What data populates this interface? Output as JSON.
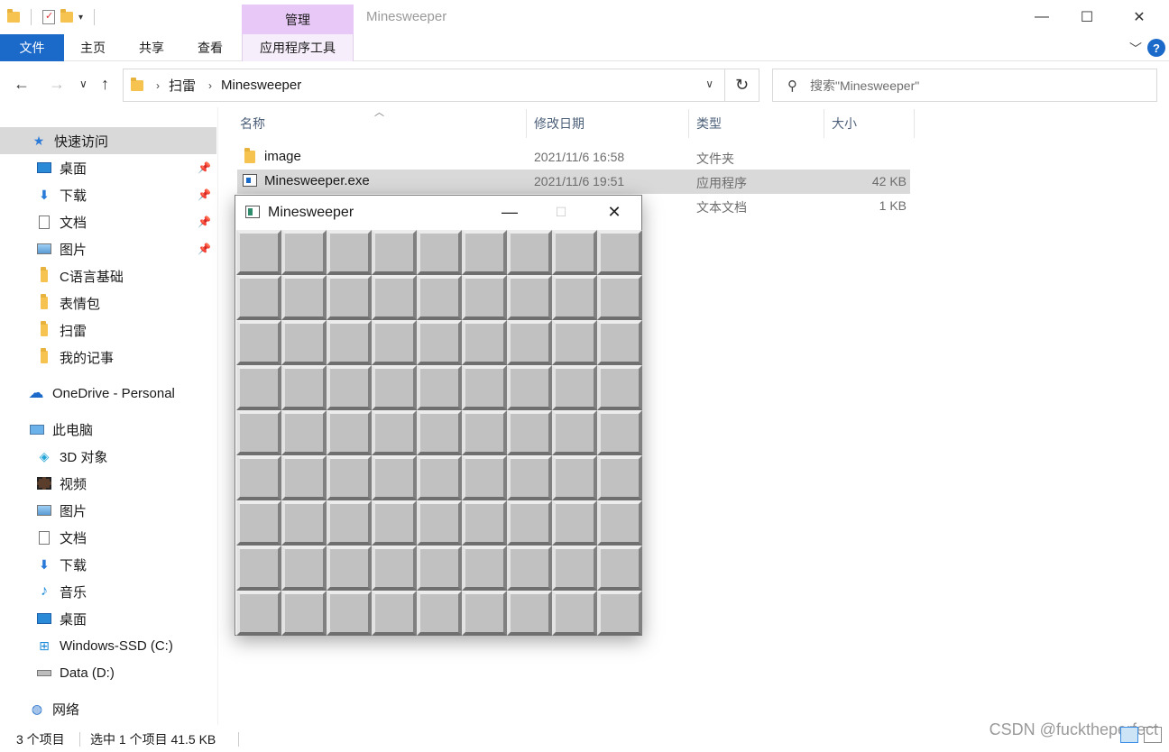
{
  "window": {
    "title": "Minesweeper",
    "context_tab_group": "管理"
  },
  "ribbon": {
    "tabs": [
      "文件",
      "主页",
      "共享",
      "查看",
      "应用程序工具"
    ],
    "help_label": "?"
  },
  "address": {
    "crumbs": [
      "扫雷",
      "Minesweeper"
    ],
    "search_placeholder": "搜索\"Minesweeper\""
  },
  "sidebar": {
    "quick_access": "快速访问",
    "items": [
      {
        "label": "快速访问",
        "icon": "star-icon"
      },
      {
        "label": "桌面",
        "icon": "desktop-icon",
        "pinned": true
      },
      {
        "label": "下载",
        "icon": "download-icon",
        "pinned": true
      },
      {
        "label": "文档",
        "icon": "document-icon",
        "pinned": true
      },
      {
        "label": "图片",
        "icon": "pictures-icon",
        "pinned": true
      },
      {
        "label": "C语言基础",
        "icon": "folder-icon"
      },
      {
        "label": "表情包",
        "icon": "folder-icon"
      },
      {
        "label": "扫雷",
        "icon": "folder-icon"
      },
      {
        "label": "我的记事",
        "icon": "folder-icon"
      },
      {
        "label": "OneDrive - Personal",
        "icon": "cloud-icon"
      },
      {
        "label": "此电脑",
        "icon": "computer-icon"
      },
      {
        "label": "3D 对象",
        "icon": "cube-icon"
      },
      {
        "label": "视频",
        "icon": "video-icon"
      },
      {
        "label": "图片",
        "icon": "pictures-icon"
      },
      {
        "label": "文档",
        "icon": "document-icon"
      },
      {
        "label": "下载",
        "icon": "download-icon"
      },
      {
        "label": "音乐",
        "icon": "music-icon"
      },
      {
        "label": "桌面",
        "icon": "desktop-icon"
      },
      {
        "label": "Windows-SSD (C:)",
        "icon": "windows-drive-icon"
      },
      {
        "label": "Data (D:)",
        "icon": "drive-icon"
      },
      {
        "label": "网络",
        "icon": "network-icon"
      }
    ]
  },
  "file_list": {
    "columns": [
      "名称",
      "修改日期",
      "类型",
      "大小"
    ],
    "rows": [
      {
        "name": "image",
        "modified": "2021/11/6 16:58",
        "type": "文件夹",
        "size": "",
        "icon": "folder-icon"
      },
      {
        "name": "Minesweeper.exe",
        "modified": "2021/11/6 19:51",
        "type": "应用程序",
        "size": "42 KB",
        "icon": "exe-icon"
      },
      {
        "name": "",
        "modified": "",
        "type": "文本文档",
        "size": "1 KB",
        "icon": "text-file-icon"
      }
    ]
  },
  "status": {
    "count": "3 个项目",
    "selected": "选中 1 个项目  41.5 KB"
  },
  "watermark": "CSDN @fucktheperfect",
  "minesweeper": {
    "title": "Minesweeper",
    "rows": 9,
    "cols": 9
  },
  "colors": {
    "accent": "#1b6ac9",
    "context_tab": "#e8c8f7",
    "selection": "#d9d9d9",
    "tile": "#c1c1c1"
  }
}
